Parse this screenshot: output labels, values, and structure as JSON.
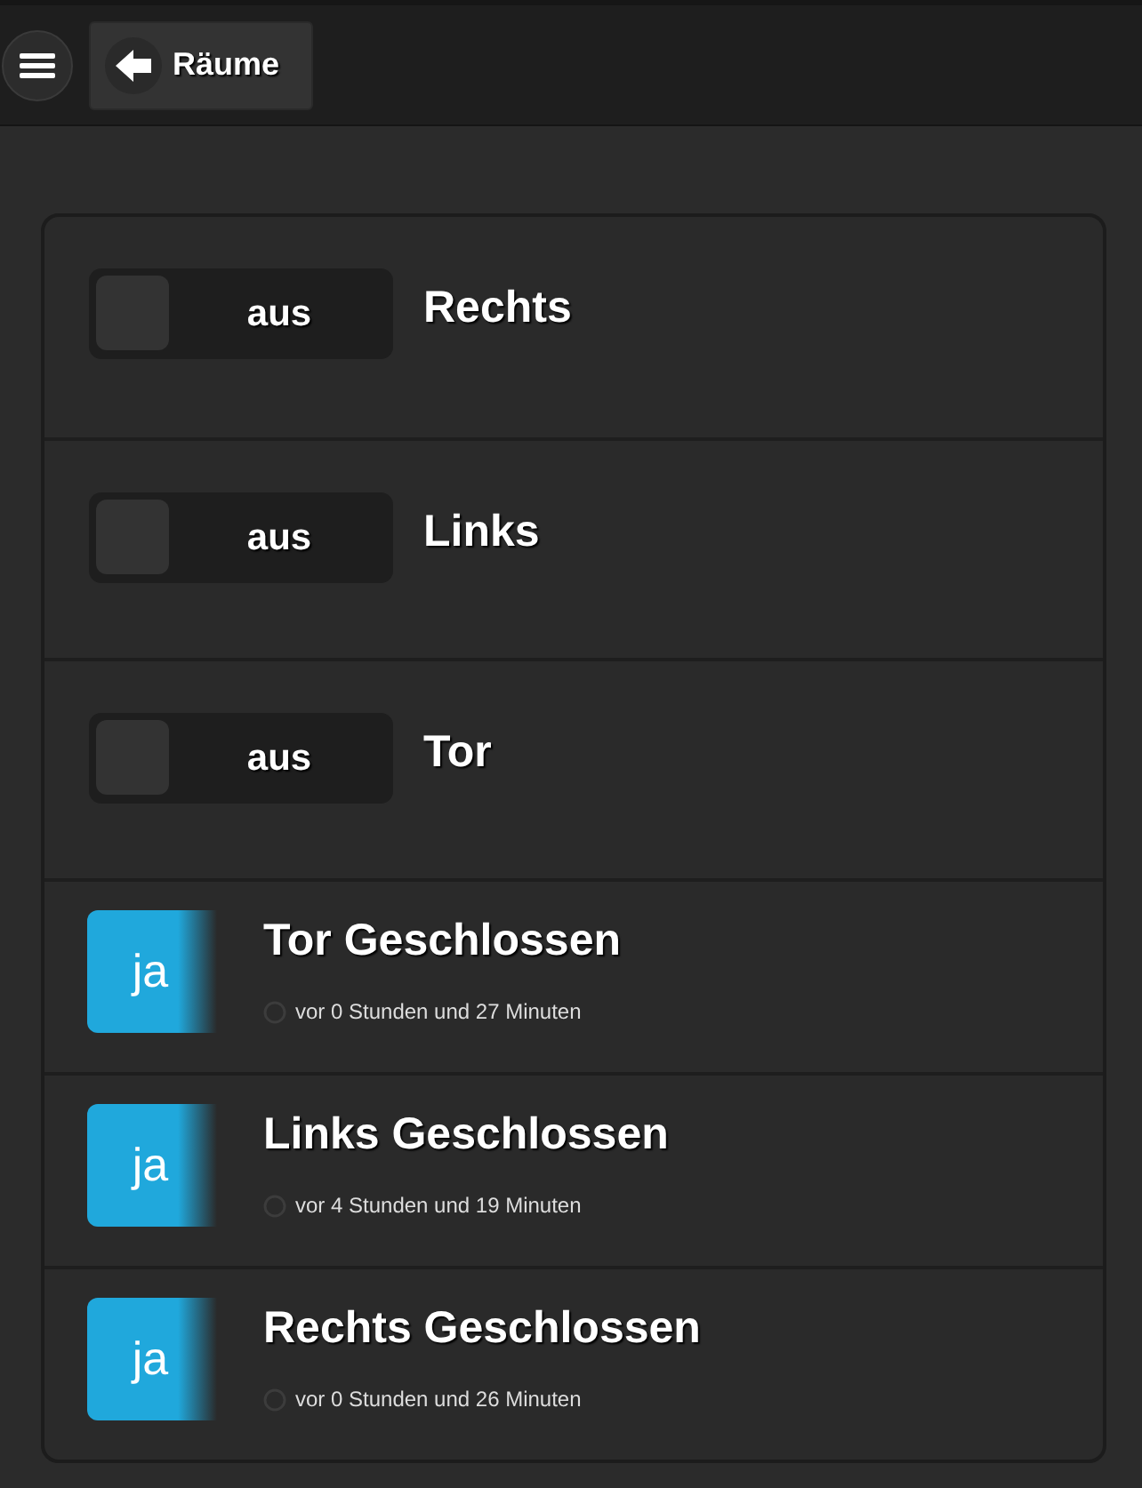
{
  "header": {
    "back_label": "Räume"
  },
  "items": [
    {
      "kind": "switch",
      "title": "Rechts",
      "on": false,
      "state_label": "aus"
    },
    {
      "kind": "switch",
      "title": "Links",
      "on": false,
      "state_label": "aus"
    },
    {
      "kind": "switch",
      "title": "Tor",
      "on": false,
      "state_label": "aus"
    },
    {
      "kind": "sensor",
      "title": "Tor Geschlossen",
      "value": "ja",
      "time": "vor 0 Stunden und 27 Minuten"
    },
    {
      "kind": "sensor",
      "title": "Links Geschlossen",
      "value": "ja",
      "time": "vor 4 Stunden und 19 Minuten"
    },
    {
      "kind": "sensor",
      "title": "Rechts Geschlossen",
      "value": "ja",
      "time": "vor 0 Stunden und 26 Minuten"
    }
  ]
}
